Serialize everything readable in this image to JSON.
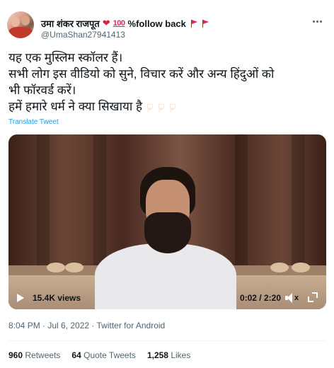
{
  "author": {
    "display_name": "उमा शंकर राजपूत",
    "emoji_heart": "❤",
    "emoji_hundred": "100",
    "follow_text": "%follow back",
    "handle": "@UmaShan27941413"
  },
  "tweet": {
    "lines": [
      "यह एक मुस्लिम स्कॉलर हैं।",
      "सभी लोग इस वीडियो को सुने, विचार करें और अन्य हिंदुओं को",
      "भी फॉरवर्ड करें।",
      "हमें हमारे धर्म ने क्या सिखाया है"
    ],
    "translate_label": "Translate Tweet"
  },
  "video": {
    "views": "15.4K views",
    "time": "0:02 / 2:20",
    "icons": [
      "play-icon",
      "volume-muted-icon",
      "fullscreen-icon"
    ]
  },
  "meta": {
    "timestamp": "8:04 PM · Jul 6, 2022 · Twitter for Android"
  },
  "stats": {
    "retweets_count": "960",
    "retweets_label": "Retweets",
    "quotes_count": "64",
    "quotes_label": "Quote Tweets",
    "likes_count": "1,258",
    "likes_label": "Likes"
  },
  "colors": {
    "link": "#1d9bf0",
    "secondary_text": "#536471",
    "primary_text": "#0f1419"
  }
}
